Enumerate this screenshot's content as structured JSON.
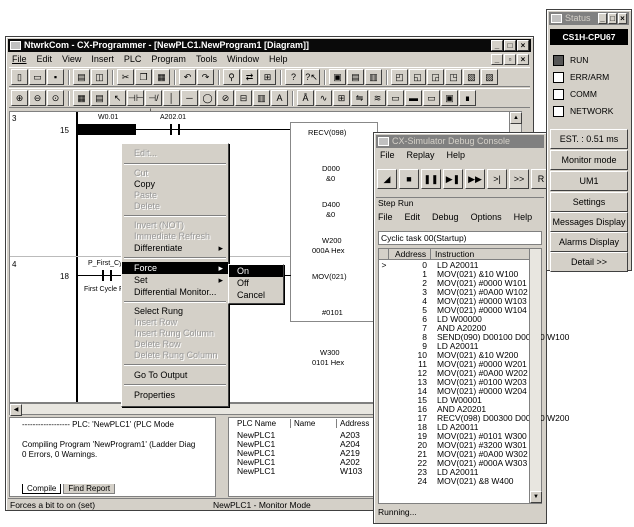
{
  "main_window": {
    "title": "NtwrkCom - CX-Programmer - [NewPLC1.NewProgram1 [Diagram]]",
    "menu": [
      "File",
      "Edit",
      "View",
      "Insert",
      "PLC",
      "Program",
      "Tools",
      "Window",
      "Help"
    ],
    "status_bar_left": "Forces a bit to on (set)",
    "status_bar_mid": "NewPLC1 - Monitor Mode"
  },
  "ladder": {
    "rung1_number": "3",
    "rung1_step": "15",
    "rung1_contact1": "W0.01",
    "rung1_contact2": "A202.01",
    "rung1_instr": "RECV(098)",
    "rung1_op1": "D000",
    "rung1_op1_val": "&0",
    "rung1_op2": "D400",
    "rung1_op2_val": "&0",
    "rung1_op3": "W200",
    "rung1_op3_val": "000A Hex",
    "rung2_number": "4",
    "rung2_step": "18",
    "rung2_contact": "P_First_Cycl",
    "rung2_comment": "First Cycle F",
    "rung2_instr": "MOV(021)",
    "rung2_op1": "#0101",
    "rung2_op2": "W300",
    "rung2_op2_val": "0101 Hex"
  },
  "context_menu": {
    "items": [
      "Edit...",
      "Cut",
      "Copy",
      "Paste",
      "Delete",
      "Invert (NOT)",
      "Immediate Refresh",
      "Differentiate",
      "Force",
      "Set",
      "Differential Monitor...",
      "Select Rung",
      "Insert Row",
      "Insert Rung Column",
      "Delete Row",
      "Delete Rung Column",
      "Go To Output",
      "Properties"
    ]
  },
  "force_submenu": {
    "items": [
      "On",
      "Off",
      "Cancel"
    ]
  },
  "output_panel": {
    "header": "------------------ PLC: 'NewPLC1' (PLC Mode",
    "line1": "Compiling Program 'NewProgram1' (Ladder Diag",
    "line2": "0 Errors, 0 Warnings.",
    "tab1": "Compile",
    "tab2": "Find Report"
  },
  "watch_panel": {
    "headers": [
      "PLC Name",
      "Name",
      "Address"
    ],
    "rows": [
      [
        "NewPLC1",
        "",
        "A203"
      ],
      [
        "NewPLC1",
        "",
        "A204"
      ],
      [
        "NewPLC1",
        "",
        "A219"
      ],
      [
        "NewPLC1",
        "",
        "A202"
      ],
      [
        "NewPLC1",
        "",
        "W103"
      ]
    ]
  },
  "sim_console": {
    "title": "CX-Simulator Debug Console",
    "menu": [
      "File",
      "Replay",
      "Help"
    ],
    "extra_btn": "R"
  },
  "step_run": {
    "title": "Step Run",
    "menu": [
      "File",
      "Edit",
      "Debug",
      "Options",
      "Help"
    ],
    "task": "Cyclic task 00(Startup)",
    "col_address": "Address",
    "col_instruction": "Instruction",
    "rows": [
      [
        ">",
        "0",
        "LD  A20011"
      ],
      [
        "",
        "1",
        "MOV(021)  &10 W100"
      ],
      [
        "",
        "2",
        "MOV(021)  #0000 W101"
      ],
      [
        "",
        "3",
        "MOV(021)  #0A00 W102"
      ],
      [
        "",
        "4",
        "MOV(021)  #0000 W103"
      ],
      [
        "",
        "5",
        "MOV(021)  #0000 W104"
      ],
      [
        "",
        "6",
        "LD  W00000"
      ],
      [
        "",
        "7",
        "AND  A20200"
      ],
      [
        "",
        "8",
        "SEND(090)  D00100 D00200 W100"
      ],
      [
        "",
        "9",
        "LD  A20011"
      ],
      [
        "",
        "10",
        "MOV(021)  &10 W200"
      ],
      [
        "",
        "11",
        "MOV(021)  #0000 W201"
      ],
      [
        "",
        "12",
        "MOV(021)  #0A00 W202"
      ],
      [
        "",
        "13",
        "MOV(021)  #0100 W203"
      ],
      [
        "",
        "14",
        "MOV(021)  #0000 W204"
      ],
      [
        "",
        "15",
        "LD  W00001"
      ],
      [
        "",
        "16",
        "AND  A20201"
      ],
      [
        "",
        "17",
        "RECV(098)  D00300 D00400 W200"
      ],
      [
        "",
        "18",
        "LD  A20011"
      ],
      [
        "",
        "19",
        "MOV(021)  #0101 W300"
      ],
      [
        "",
        "20",
        "MOV(021)  #3200 W301"
      ],
      [
        "",
        "21",
        "MOV(021)  #0A00 W302"
      ],
      [
        "",
        "22",
        "MOV(021)  #000A W303"
      ],
      [
        "",
        "23",
        "LD  A20011"
      ],
      [
        "",
        "24",
        "MOV(021)  &8 W400"
      ]
    ],
    "status": "Running..."
  },
  "status_window": {
    "title": "Status",
    "cpu": "CS1H-CPU67",
    "indicators": [
      {
        "label": "RUN",
        "on": true
      },
      {
        "label": "ERR/ARM",
        "on": false
      },
      {
        "label": "COMM",
        "on": false
      },
      {
        "label": "NETWORK",
        "on": false
      }
    ],
    "cycle": "EST. : 0.51 ms",
    "mode_label": "Monitor mode",
    "unit": "UM1",
    "buttons": [
      "Settings",
      "Messages Display",
      "Alarms Display",
      "Detail >>"
    ]
  }
}
